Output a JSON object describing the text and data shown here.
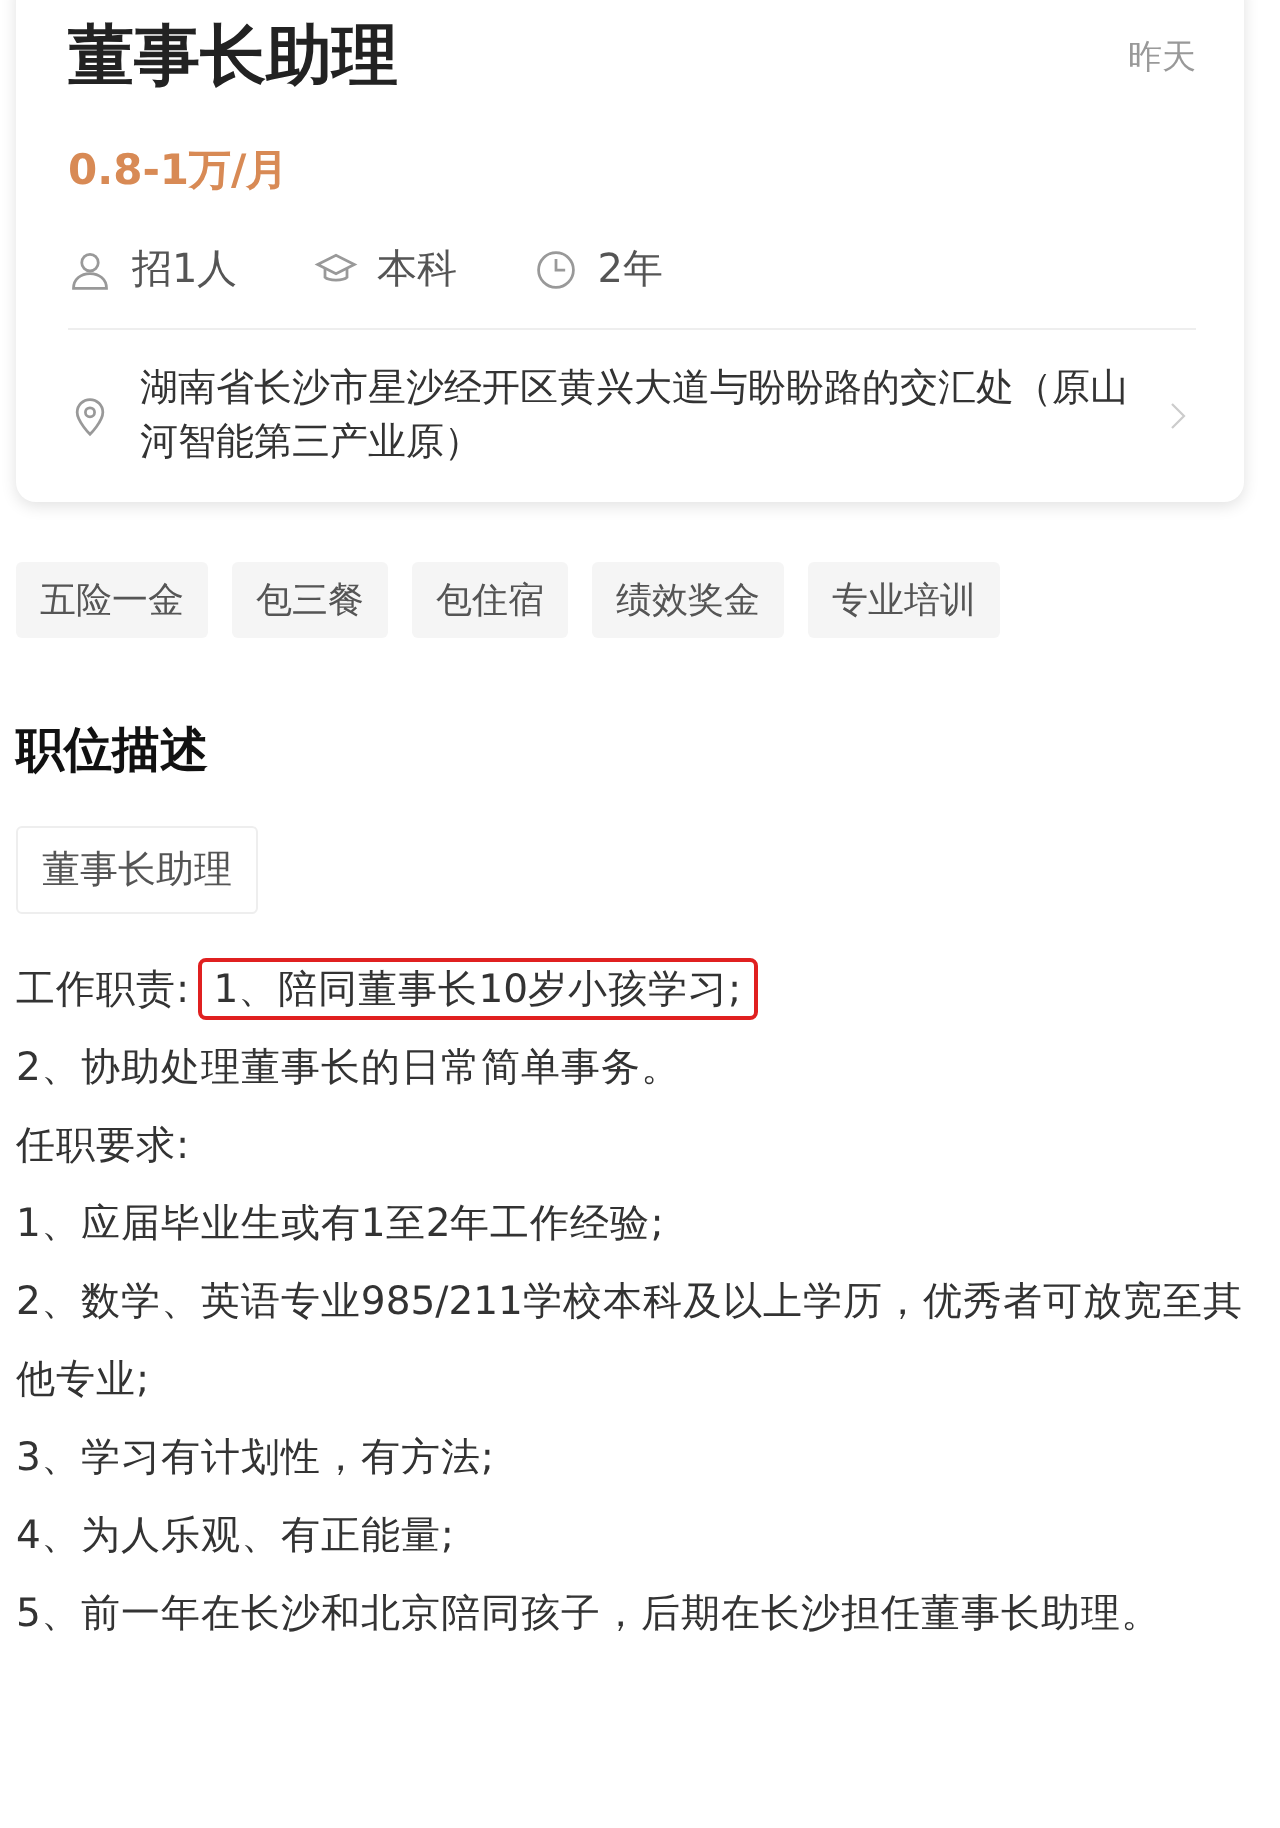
{
  "job": {
    "title": "董事长助理",
    "posted": "昨天",
    "salary": "0.8-1万/月",
    "meta": [
      {
        "kind": "headcount",
        "text": "招1人"
      },
      {
        "kind": "education",
        "text": "本科"
      },
      {
        "kind": "experience",
        "text": "2年"
      }
    ],
    "address": "湖南省长沙市星沙经开区黄兴大道与盼盼路的交汇处（原山河智能第三产业原）"
  },
  "benefits": [
    "五险一金",
    "包三餐",
    "包住宿",
    "绩效奖金",
    "专业培训"
  ],
  "description": {
    "heading": "职位描述",
    "category": "董事长助理",
    "lines": [
      {
        "label": "工作职责:",
        "text": "1、陪同董事长10岁小孩学习;",
        "highlighted": true
      },
      {
        "text": "2、协助处理董事长的日常简单事务。",
        "highlighted": false
      },
      {
        "text": "任职要求:",
        "highlighted": false
      },
      {
        "text": "1、应届毕业生或有1至2年工作经验;",
        "highlighted": false
      },
      {
        "text": "2、数学、英语专业985/211学校本科及以上学历，优秀者可放宽至其他专业;",
        "highlighted": false
      },
      {
        "text": "3、学习有计划性，有方法;",
        "highlighted": false
      },
      {
        "text": "4、为人乐观、有正能量;",
        "highlighted": false
      },
      {
        "text": "5、前一年在长沙和北京陪同孩子，后期在长沙担任董事长助理。",
        "highlighted": false
      }
    ]
  }
}
